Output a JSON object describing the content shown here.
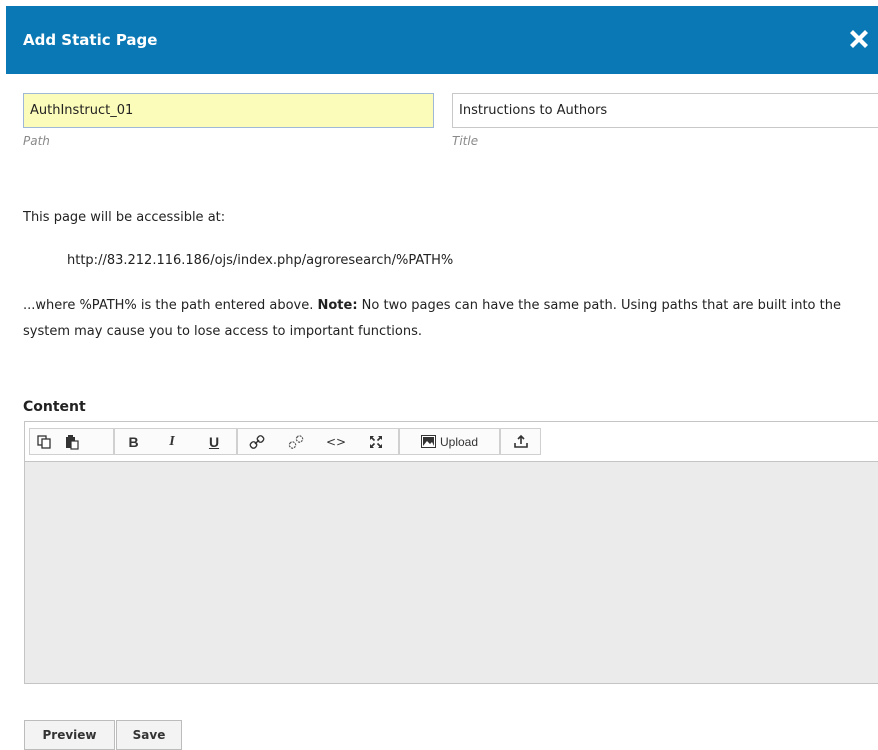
{
  "colors": {
    "header_bg": "#0a78b4",
    "path_field_bg": "#fcfcba",
    "editor_bg": "#ebebeb",
    "link": "#1a44d6"
  },
  "header": {
    "title": "Add Static Page",
    "close_icon": "close-icon"
  },
  "form": {
    "path": {
      "value": "AuthInstruct_01",
      "label": "Path"
    },
    "title": {
      "value": "Instructions to Authors",
      "label": "Title"
    }
  },
  "info": {
    "accessible_text": "This page will be accessible at:",
    "url": "http://83.212.116.186/ojs/index.php/agroresearch/%PATH%",
    "where_prefix": "...where %PATH% is the path entered above. ",
    "note_label": "Note:",
    "where_suffix": " No two pages can have the same path. Using paths that are built into the system may cause you to lose access to important functions."
  },
  "editor": {
    "label": "Content",
    "toolbar": {
      "copy_icon": "copy-icon",
      "paste_icon": "paste-icon",
      "bold_label": "B",
      "italic_label": "I",
      "underline_label": "U",
      "link_icon": "link-icon",
      "unlink_icon": "unlink-icon",
      "code_label": "<>",
      "fullscreen_icon": "fullscreen-icon",
      "upload_label": "Upload",
      "download_icon": "insert-file-icon"
    }
  },
  "actions": {
    "preview_label": "Preview",
    "save_label": "Save"
  }
}
